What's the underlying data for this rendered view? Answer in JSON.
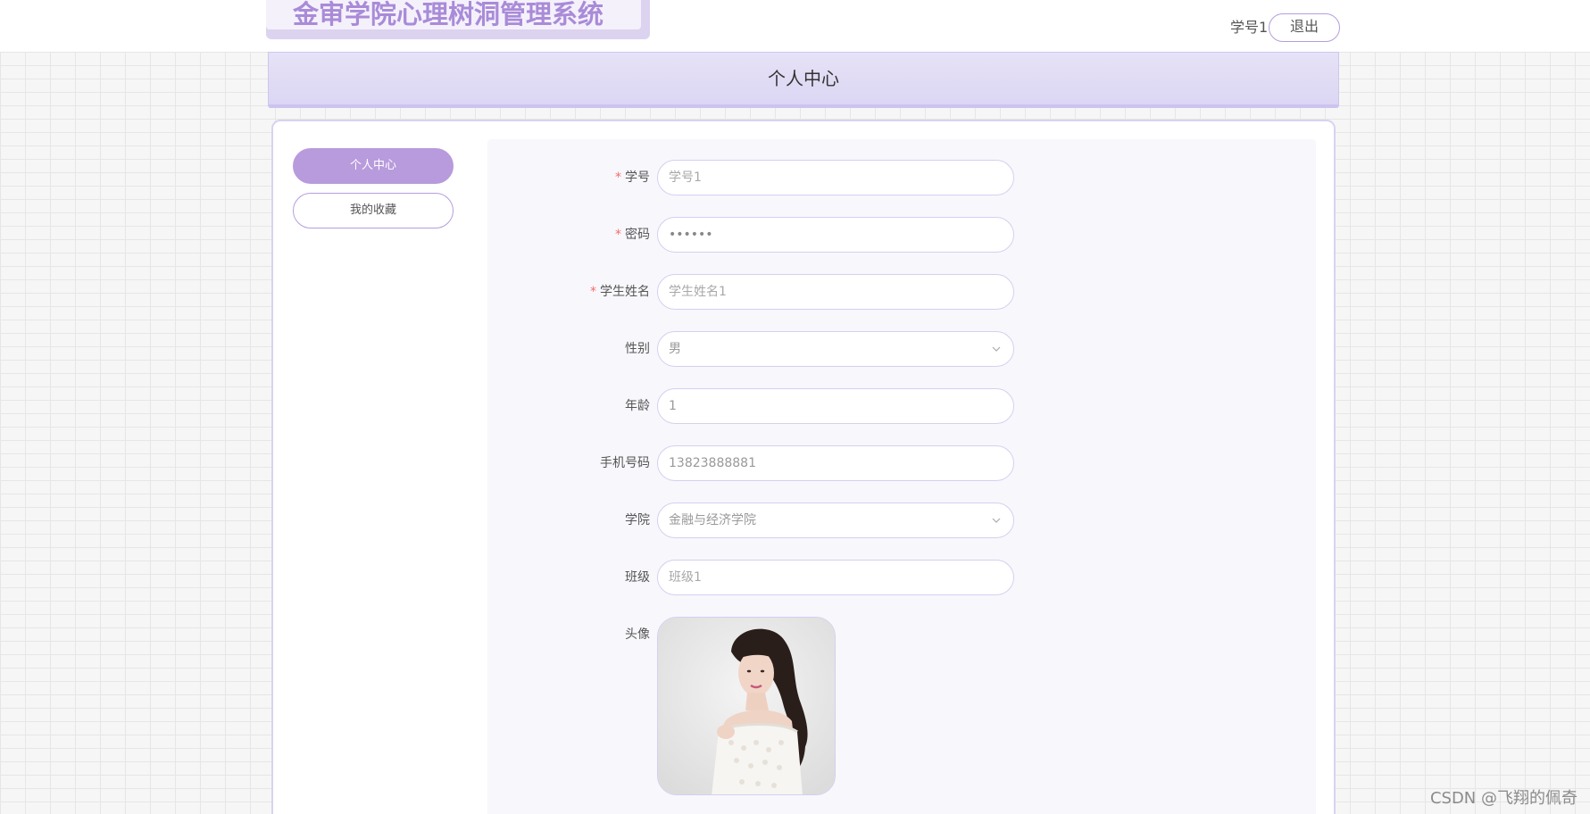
{
  "header": {
    "app_title": "金审学院心理树洞管理系统",
    "user_name": "学号1",
    "logout_label": "退出"
  },
  "page_title": "个人中心",
  "sidebar": {
    "items": [
      {
        "label": "个人中心",
        "active": true
      },
      {
        "label": "我的收藏",
        "active": false
      }
    ]
  },
  "form": {
    "student_id": {
      "label": "学号",
      "required": "*",
      "placeholder": "学号1"
    },
    "password": {
      "label": "密码",
      "required": "*",
      "value": "••••••"
    },
    "student_name": {
      "label": "学生姓名",
      "required": "*",
      "placeholder": "学生姓名1"
    },
    "gender": {
      "label": "性别",
      "selected": "男"
    },
    "age": {
      "label": "年龄",
      "value": "1"
    },
    "phone": {
      "label": "手机号码",
      "value": "13823888881"
    },
    "college": {
      "label": "学院",
      "selected": "金融与经济学院"
    },
    "class": {
      "label": "班级",
      "placeholder": "班级1"
    },
    "avatar": {
      "label": "头像"
    }
  },
  "watermark": "CSDN @飞翔的佩奇",
  "colors": {
    "accent": "#b89bdc",
    "title_bar": "#dcd6f3",
    "required": "#f56c6c"
  }
}
